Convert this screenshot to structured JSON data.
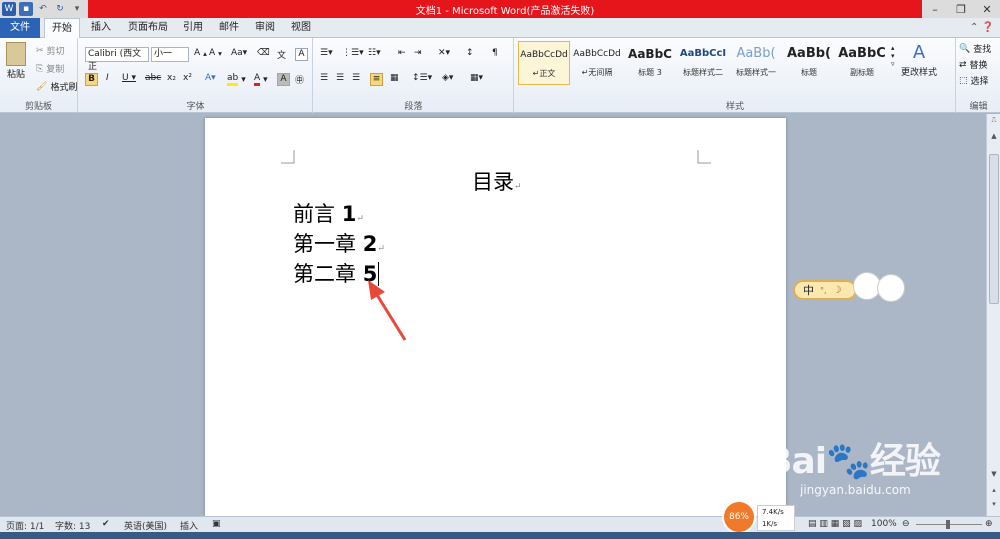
{
  "window": {
    "title": "文档1 - Microsoft Word(产品激活失败)"
  },
  "tabs": [
    {
      "label": "文件"
    },
    {
      "label": "开始"
    },
    {
      "label": "插入"
    },
    {
      "label": "页面布局"
    },
    {
      "label": "引用"
    },
    {
      "label": "邮件"
    },
    {
      "label": "审阅"
    },
    {
      "label": "视图"
    }
  ],
  "ribbon": {
    "clipboard": {
      "paste": "粘贴",
      "cut": "剪切",
      "copy": "复制",
      "format_painter": "格式刷",
      "group": "剪贴板"
    },
    "font": {
      "font_name": "Calibri (西文正",
      "font_size": "小一",
      "group": "字体"
    },
    "paragraph": {
      "group": "段落"
    },
    "styles": {
      "group": "样式",
      "items": [
        {
          "preview": "AaBbCcDd",
          "name": "↵正文"
        },
        {
          "preview": "AaBbCcDd",
          "name": "↵无间隔"
        },
        {
          "preview": "AaBbC",
          "name": "标题 3"
        },
        {
          "preview": "AaBbCcI",
          "name": "标题样式二"
        },
        {
          "preview": "AaBb(",
          "name": "标题样式一"
        },
        {
          "preview": "AaBb(",
          "name": "标题"
        },
        {
          "preview": "AaBbC",
          "name": "副标题"
        }
      ],
      "change_styles": "更改样式"
    },
    "editing": {
      "find": "查找",
      "replace": "替换",
      "select": "选择",
      "group": "编辑"
    }
  },
  "document": {
    "title": "目录",
    "lines": [
      {
        "text": "前言",
        "page": "1"
      },
      {
        "text": "第一章",
        "page": "2"
      },
      {
        "text": "第二章",
        "page": "5"
      }
    ]
  },
  "ime": {
    "mode": "中"
  },
  "status": {
    "page": "页面: 1/1",
    "words": "字数: 13",
    "language": "英语(美国)",
    "mode": "插入",
    "zoom": "100%"
  },
  "network": {
    "percent": "86%",
    "up": "7.4K/s",
    "down": "1K/s"
  },
  "watermark": {
    "brand": "Bai",
    "brand2": "经验",
    "url": "jingyan.baidu.com"
  }
}
